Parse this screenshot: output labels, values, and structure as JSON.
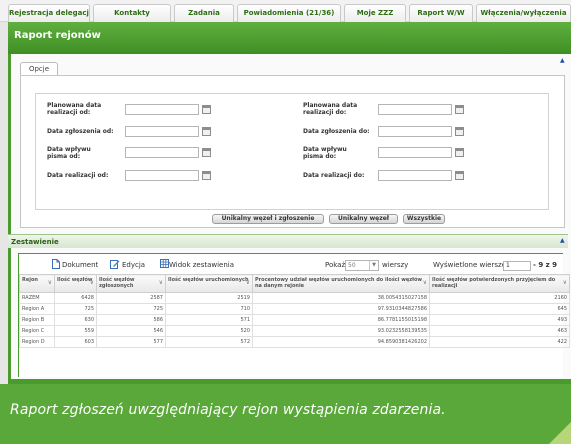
{
  "top_nav": {
    "tabs": [
      {
        "label": "Rejestracja delegacji"
      },
      {
        "label": "Kontakty"
      },
      {
        "label": "Zadania"
      },
      {
        "label": "Powiadomienia (21/36)"
      },
      {
        "label": "Moje ZZZ"
      },
      {
        "label": "Raport W/W"
      },
      {
        "label": "Włączenia/wyłączenia"
      }
    ]
  },
  "page": {
    "title": "Raport rejonów"
  },
  "opcje": {
    "tab_label": "Opcje",
    "fields": [
      {
        "label": "Planowana data realizacji od:",
        "value": ""
      },
      {
        "label": "Planowana data realizacji do:",
        "value": ""
      },
      {
        "label": "Data zgłoszenia od:",
        "value": ""
      },
      {
        "label": "Data zgłoszenia do:",
        "value": ""
      },
      {
        "label": "Data wpływu pisma od:",
        "value": ""
      },
      {
        "label": "Data wpływu pisma do:",
        "value": ""
      },
      {
        "label": "Data realizacji od:",
        "value": ""
      },
      {
        "label": "Data realizacji do:",
        "value": ""
      }
    ],
    "buttons": {
      "unique_with_report": "Unikalny węzeł i zgłoszenie",
      "unique": "Unikalny węzeł",
      "all": "Wszystkie"
    }
  },
  "zestawienie": {
    "title": "Zestawienie",
    "toolbar": {
      "document": "Dokument",
      "edit": "Edycja",
      "view": "Widok zestawienia",
      "show_label": "Pokaż",
      "show_value": "50",
      "rows_label": "wierszy",
      "displayed_label": "Wyświetlone wiersze",
      "displayed_from": "1",
      "displayed_range": "- 9 z 9"
    },
    "columns": [
      "Rejon",
      "Ilość węzłów",
      "Ilość węzłów zgłoszonych",
      "Ilość węzłów uruchomionych",
      "Procentowy udział węzłów uruchomionych do ilości węzłów na danym rejonie",
      "Ilość węzłów potwierdzonych przyjęciem do realizacji"
    ],
    "rows": [
      [
        "RAZEM",
        "6428",
        "2587",
        "2519",
        "38.0054315027158",
        "2160"
      ],
      [
        "Region A",
        "725",
        "725",
        "710",
        "97.9310344827586",
        "645"
      ],
      [
        "Region B",
        "630",
        "586",
        "571",
        "86.7781155015198",
        "493"
      ],
      [
        "Region C",
        "559",
        "546",
        "520",
        "93.0232558139535",
        "463"
      ],
      [
        "Region D",
        "603",
        "577",
        "572",
        "94.8590381426202",
        "422"
      ]
    ]
  },
  "caption": {
    "text": "Raport zgłoszeń uwzględniający rejon wystąpienia zdarzenia."
  }
}
